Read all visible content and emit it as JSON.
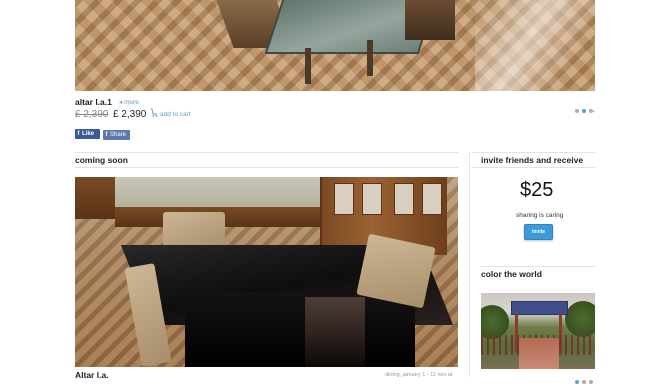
{
  "featured": {
    "title": "altar l.a.1",
    "more_label": "◂ more",
    "price_old": "£ 2,390",
    "price_new": "£ 2,390",
    "add_to_cart_label": "add to cart",
    "slides_total": 3,
    "slide_active": 2
  },
  "social": {
    "like_label": "Like",
    "share_label": "Share",
    "facebook_glyph": "f"
  },
  "coming_soon": {
    "heading": "coming soon",
    "caption": "Altar l.a.",
    "caption_meta": "dining, january 1 - 11 nov at"
  },
  "invite": {
    "heading": "invite friends and receive",
    "amount": "$25",
    "subtext": "sharing is caring",
    "button_label": "invite"
  },
  "world": {
    "heading": "color the world",
    "slides_total": 3,
    "slide_active": 1
  },
  "icons": {
    "cart": "shopping-cart-icon",
    "facebook": "facebook-icon"
  },
  "colors": {
    "link": "#5aa0cc",
    "facebook": "#3b5998",
    "invite_button": "#3d9ad8"
  }
}
